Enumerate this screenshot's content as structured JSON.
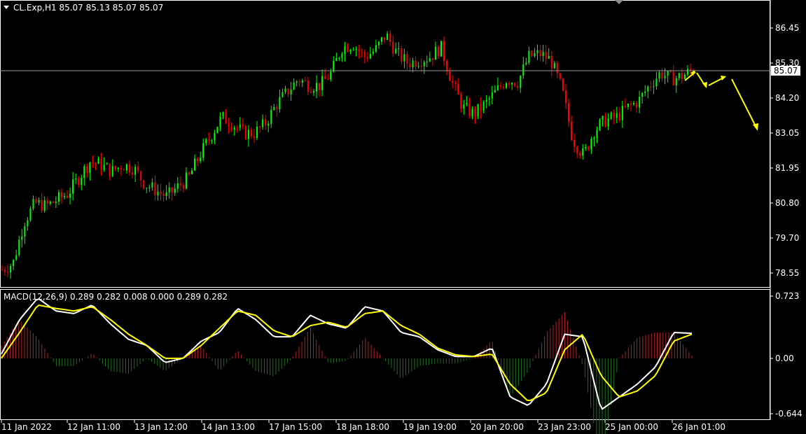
{
  "header": {
    "symbol_line": "CL.Exp,H1  85.07 85.13 85.07 85.07",
    "macd_line": "MACD(12,26,9) 0.289 0.282 0.008 0.000 0.289 0.282"
  },
  "price_axis": {
    "labels": [
      "86.45",
      "85.30",
      "84.20",
      "83.05",
      "81.95",
      "80.80",
      "79.70",
      "78.55"
    ],
    "current_price": "85.07"
  },
  "macd_axis": {
    "labels": [
      "0.723",
      "0.00",
      "-0.644"
    ]
  },
  "time_axis": {
    "labels": [
      "11 Jan 2022",
      "12 Jan 11:00",
      "13 Jan 12:00",
      "14 Jan 13:00",
      "17 Jan 15:00",
      "18 Jan 18:00",
      "19 Jan 19:00",
      "20 Jan 20:00",
      "23 Jan 23:00",
      "25 Jan 00:00",
      "26 Jan 01:00"
    ]
  },
  "colors": {
    "up_candle": "#00ff00",
    "down_candle": "#ff0000",
    "macd_line": "#ffffff",
    "signal_line": "#ffff00",
    "hist_positive": "#b22222",
    "hist_negative": "#1f6f1f",
    "arrows": "#ffff00",
    "current_price_line": "#9a9a9a"
  },
  "chart_data": [
    {
      "type": "candlestick",
      "series_hint": "close price path approximated",
      "x_labels": [
        "11 Jan 2022",
        "12 Jan 11:00",
        "13 Jan 12:00",
        "14 Jan 13:00",
        "17 Jan 15:00",
        "18 Jan 18:00",
        "19 Jan 19:00",
        "20 Jan 20:00",
        "23 Jan 23:00",
        "25 Jan 00:00",
        "26 Jan 01:00"
      ],
      "close": [
        78.7,
        78.9,
        80.2,
        80.8,
        80.7,
        80.9,
        81.1,
        81.6,
        82.1,
        82.0,
        81.8,
        82.0,
        81.9,
        81.4,
        81.2,
        81.0,
        81.3,
        81.6,
        82.3,
        82.9,
        83.5,
        83.3,
        83.0,
        83.0,
        83.3,
        83.9,
        84.3,
        84.7,
        84.5,
        84.5,
        84.9,
        85.7,
        85.8,
        85.4,
        85.6,
        86.1,
        85.5,
        85.2,
        85.3,
        85.4,
        85.7,
        84.6,
        83.8,
        83.6,
        83.9,
        84.3,
        84.7,
        84.6,
        85.4,
        85.5,
        85.3,
        84.4,
        82.8,
        82.3,
        83.1,
        83.4,
        83.5,
        83.8,
        84.0,
        84.5,
        84.9,
        84.7,
        84.8,
        85.0
      ],
      "ylim": [
        78.2,
        87.1
      ]
    },
    {
      "type": "line",
      "series": [
        {
          "name": "MACD",
          "values": [
            0.05,
            0.45,
            0.7,
            0.55,
            0.52,
            0.62,
            0.4,
            0.22,
            0.15,
            -0.05,
            0.0,
            0.2,
            0.3,
            0.58,
            0.45,
            0.25,
            0.25,
            0.5,
            0.4,
            0.35,
            0.6,
            0.55,
            0.3,
            0.25,
            0.1,
            0.02,
            0.02,
            0.12,
            -0.45,
            -0.55,
            -0.3,
            0.28,
            0.25,
            -0.6,
            -0.45,
            -0.3,
            -0.1,
            0.3,
            0.29
          ]
        },
        {
          "name": "Signal",
          "values": [
            0.0,
            0.3,
            0.62,
            0.58,
            0.55,
            0.6,
            0.45,
            0.28,
            0.15,
            0.0,
            0.0,
            0.15,
            0.35,
            0.55,
            0.5,
            0.32,
            0.25,
            0.38,
            0.42,
            0.36,
            0.52,
            0.55,
            0.38,
            0.28,
            0.12,
            0.04,
            0.02,
            0.05,
            -0.3,
            -0.5,
            -0.4,
            0.1,
            0.28,
            -0.2,
            -0.45,
            -0.38,
            -0.2,
            0.2,
            0.28
          ]
        }
      ],
      "ylim": [
        -0.644,
        0.723
      ]
    }
  ]
}
